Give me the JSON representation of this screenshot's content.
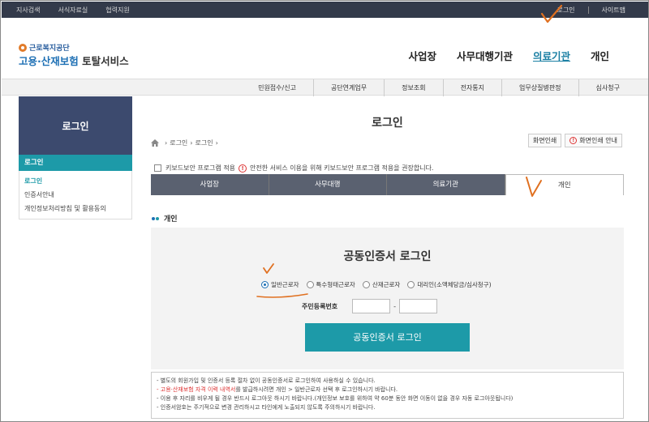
{
  "topbar": {
    "left": [
      "지사검색",
      "서식자료실",
      "협력지원"
    ],
    "right": [
      "로그인",
      "사이트맵"
    ]
  },
  "logo": {
    "small": "근로복지공단",
    "big_colored": "고용·산재보험",
    "big_dark": " 토탈서비스"
  },
  "mainnav": [
    "사업장",
    "사무대행기관",
    "의료기관",
    "개인"
  ],
  "subnav": [
    "민원접수/신고",
    "공단연계업무",
    "정보조회",
    "전자통지",
    "업무상질병판정",
    "심사청구"
  ],
  "side": {
    "head": "로그인",
    "active": "로그인",
    "items": [
      "로그인",
      "인증서안내",
      "개인정보처리방침 및 활용동의"
    ]
  },
  "page": {
    "title": "로그인",
    "breadcrumb": [
      "로그인",
      "로그인"
    ],
    "print_btn": "화면인쇄",
    "print_guide_btn": "화면인쇄 안내"
  },
  "notice": {
    "left": "키보드보안 프로그램 적용",
    "right": "안전한 서비스 이용을 위해 키보드보안 프로그램 적용을 권장합니다."
  },
  "tabs": [
    "사업장",
    "사무대행",
    "의료기관",
    "개인"
  ],
  "section_title": "개인",
  "login": {
    "title": "공동인증서 로그인",
    "radios": [
      "일반근로자",
      "특수형태근로자",
      "산재근로자",
      "대리인(소액체당금/심사청구)"
    ],
    "id_label": "주민등록번호",
    "dash": "-",
    "button": "공동인증서 로그인"
  },
  "info": {
    "line1": "- 별도의 회원가입 및 인증서 등록 절차 없이 공동인증서로 로그인하여 사용하실 수 있습니다.",
    "line2_red": "- 고용·산재보험 자격 이력 내역서",
    "line2_rest": "를 발급하시려면 개인 > 일반근로자 선택 후 로그인하시기 바랍니다.",
    "line3": "- 이용 후 자리를 비우게 될 경우 반드시 로그아웃 하시기 바랍니다.(개인정보 보호를 위하여 약 60분 동안 화면 이동이 없을 경우 자동 로그아웃됩니다)",
    "line4": "- 인증서암호는 주기적으로 변경 관리하시고 타인에게 노출되지 않도록 주의하시기 바랍니다."
  },
  "colors": {
    "topbar": "#333a4a",
    "side_head": "#3c4a6e",
    "accent": "#1d9aa8",
    "annotation": "#e07020"
  }
}
